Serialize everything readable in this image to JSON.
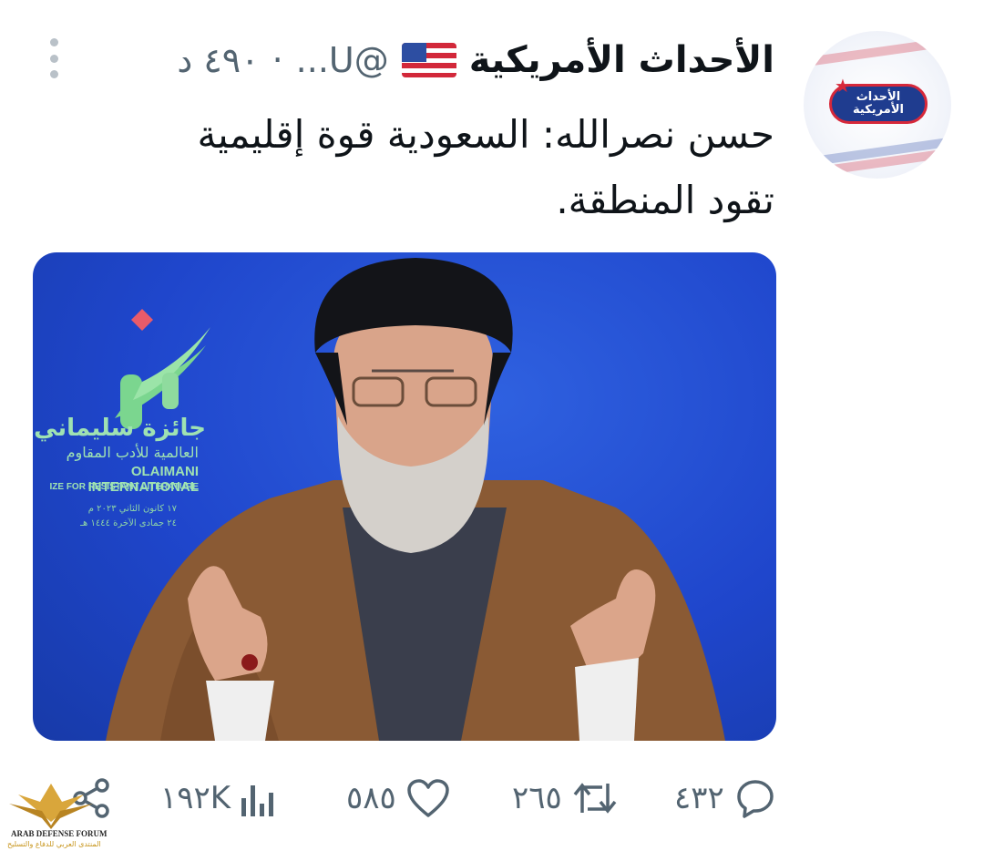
{
  "tweet": {
    "author_name": "الأحداث الأمريكية",
    "author_flag": "us-flag-icon",
    "handle": "...U@",
    "separator": "·",
    "time": "٤٩٠ د",
    "text_line1": "حسن نصرالله: السعودية قوة إقليمية",
    "text_line2": "تقود المنطقة."
  },
  "avatar": {
    "logo_line1": "الأحداث",
    "logo_line2": "الأمريكية"
  },
  "media": {
    "backdrop": {
      "prize_ar": "جائزة سليماني",
      "prize_sub_ar": "العالمية للأدب المقاوم",
      "intl_line1": "OLAIMANI INTERNATIONAL",
      "intl_line2": "IZE FOR RESISTANT LITERATURE",
      "date_line1": "١٧ كانون الثاني ٢٠٢٣ م",
      "date_line2": "٢٤ جمادى الآخرة ١٤٤٤ هـ"
    }
  },
  "actions": {
    "replies": "٤٣٢",
    "retweets": "٢٦٥",
    "likes": "٥٨٥",
    "views": "١٩٢K"
  },
  "watermark": {
    "line1": "ARAB DEFENSE FORUM",
    "line2": "المنتدى العربي للدفاع والتسليح"
  },
  "colors": {
    "accent_blue": "#1d4ccf",
    "muted": "#536471",
    "text": "#0f1419"
  }
}
